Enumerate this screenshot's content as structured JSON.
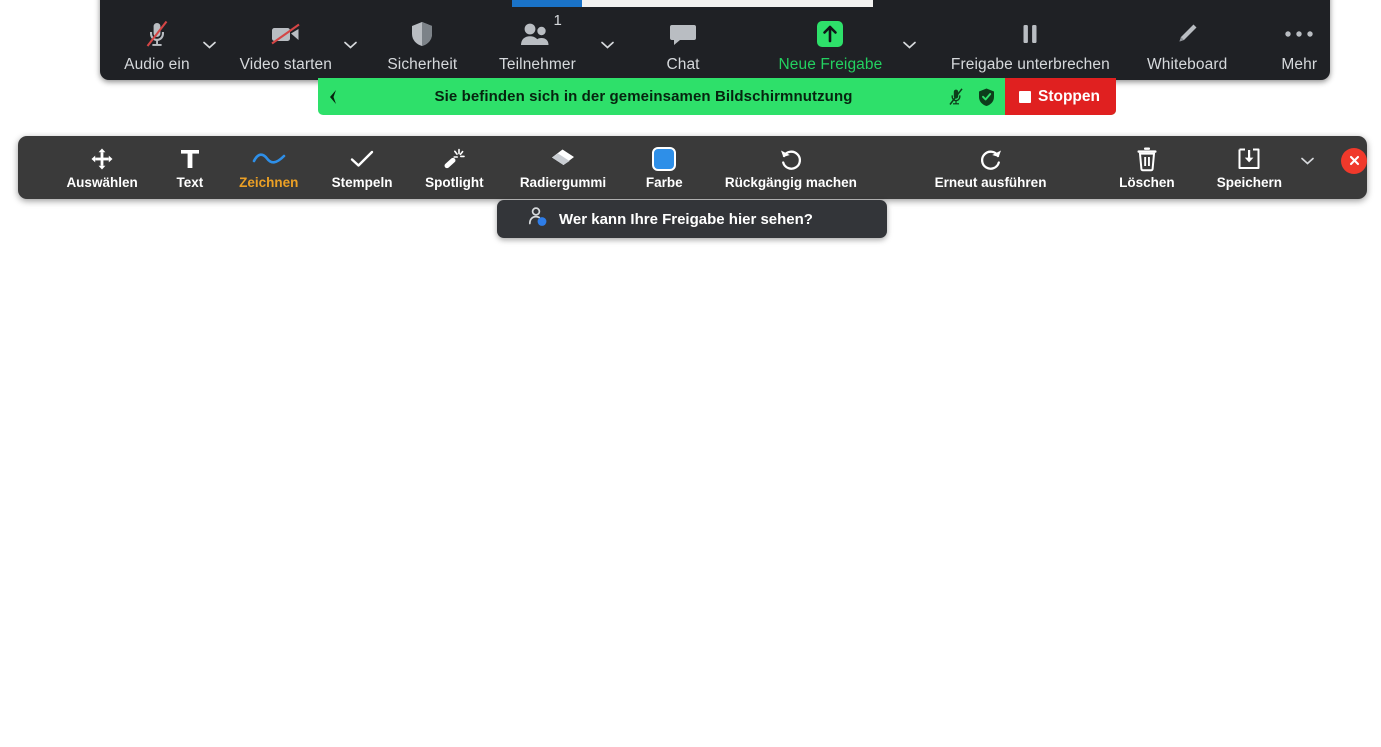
{
  "top_toolbar": {
    "items": [
      {
        "label": "Audio ein",
        "icon": "mic-muted-icon",
        "has_caret": true,
        "green": false
      },
      {
        "label": "Video starten",
        "icon": "video-muted-icon",
        "has_caret": true,
        "green": false
      },
      {
        "label": "Sicherheit",
        "icon": "shield-icon",
        "has_caret": false,
        "green": false
      },
      {
        "label": "Teilnehmer",
        "icon": "participants-icon",
        "has_caret": true,
        "green": false,
        "count": "1"
      },
      {
        "label": "Chat",
        "icon": "chat-bubble-icon",
        "has_caret": false,
        "green": false
      },
      {
        "label": "Neue Freigabe",
        "icon": "share-screen-icon",
        "has_caret": true,
        "green": true
      },
      {
        "label": "Freigabe unterbrechen",
        "icon": "pause-icon",
        "has_caret": false,
        "green": false
      },
      {
        "label": "Whiteboard",
        "icon": "pencil-icon",
        "has_caret": false,
        "green": false
      },
      {
        "label": "Mehr",
        "icon": "more-dots-icon",
        "has_caret": false,
        "green": false
      }
    ]
  },
  "share_bar": {
    "message": "Sie befinden sich in der gemeinsamen Bildschirmnutzung",
    "grip_icon": "drag-grip-icon",
    "mic_icon": "mic-muted-small-icon",
    "shield_icon": "shield-check-icon",
    "stop_label": "Stoppen",
    "colors": {
      "bar": "#2ee06a",
      "stop": "#e02020",
      "text": "#06240f"
    }
  },
  "annotation_toolbar": {
    "items": [
      {
        "label": "Auswählen",
        "icon": "move-arrows-icon",
        "active": false
      },
      {
        "label": "Text",
        "icon": "text-t-icon",
        "active": false
      },
      {
        "label": "Zeichnen",
        "icon": "draw-wave-icon",
        "active": true
      },
      {
        "label": "Stempeln",
        "icon": "checkmark-icon",
        "active": false
      },
      {
        "label": "Spotlight",
        "icon": "spotlight-wand-icon",
        "active": false
      },
      {
        "label": "Radiergummi",
        "icon": "eraser-icon",
        "active": false
      },
      {
        "label": "Farbe",
        "icon": "color-swatch-icon",
        "active": false
      },
      {
        "label": "Rückgängig machen",
        "icon": "undo-icon",
        "active": false
      },
      {
        "label": "Erneut ausführen",
        "icon": "redo-icon",
        "active": false
      },
      {
        "label": "Löschen",
        "icon": "trash-icon",
        "active": false
      },
      {
        "label": "Speichern",
        "icon": "save-download-icon",
        "active": false
      }
    ],
    "save_caret_icon": "chevron-down-icon",
    "close_icon": "close-x-icon",
    "active_color": "#eca025",
    "swatch_color": "#2e8fe8"
  },
  "tooltip": {
    "text": "Wer kann Ihre Freigabe hier sehen?",
    "icon": "person-presence-icon"
  }
}
